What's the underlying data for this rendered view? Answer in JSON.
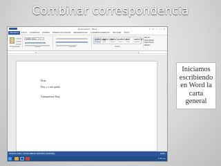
{
  "slide": {
    "title": "Combinar correspondencia",
    "note": "Iniciamos\nescribiendo\nen Word la\ncarta general"
  },
  "word": {
    "window_title": "Documento1 - Word",
    "window_controls": "? ▭ ─ ▢ ✕",
    "tabs": [
      "ARCHIVO",
      "INICIO",
      "INSERTAR",
      "DISEÑO",
      "DISEÑO DE PÁGINA",
      "REFERENCIAS",
      "CORRESPONDENCIA",
      "REVISAR",
      "VISTA"
    ],
    "active_tab": "INICIO",
    "ribbon": {
      "groups": [
        "Portapapeles",
        "Fuente",
        "Párrafo",
        "Estilos",
        "Edición"
      ],
      "font_name": "Calibri (Cuer",
      "styles": [
        {
          "sample": "AaBbCcDc",
          "name": "¶ Normal"
        },
        {
          "sample": "AaBbCcDc",
          "name": "¶ Sin espa..."
        },
        {
          "sample": "AaBbCc",
          "name": "Título 1"
        },
        {
          "sample": "AaBbCcE",
          "name": "Título 2"
        },
        {
          "sample": "AaB",
          "name": "Título"
        },
        {
          "sample": "AaBbCcD",
          "name": "Subtítulo"
        }
      ],
      "editing": [
        "Buscar",
        "Reemplazar",
        "Seleccionar"
      ]
    },
    "document_lines": [
      "Hola",
      "Hoy y e ran quedo",
      "Atentamente Rauj"
    ],
    "status": "PÁGINA 1 DE 1    10 PALABRAS    ESPAÑOL (ESPAÑA)",
    "zoom": "100%",
    "clock": "1:15 p.m."
  },
  "colors": {
    "word_blue": "#2b579a",
    "taskbar_blue": "#1f4e8a",
    "title_text": "#ffffff"
  }
}
